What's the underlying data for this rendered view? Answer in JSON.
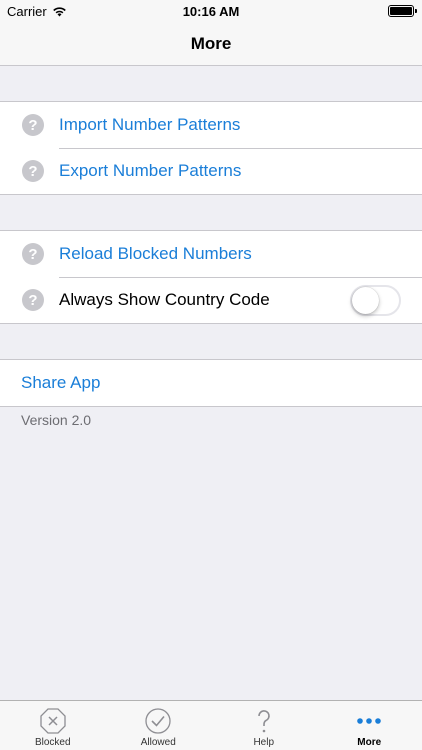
{
  "status_bar": {
    "carrier": "Carrier",
    "time": "10:16 AM"
  },
  "nav": {
    "title": "More"
  },
  "sections": {
    "patterns": [
      {
        "label": "Import Number Patterns",
        "icon": "help-icon"
      },
      {
        "label": "Export Number Patterns",
        "icon": "help-icon"
      }
    ],
    "settings": [
      {
        "label": "Reload Blocked Numbers",
        "icon": "help-icon"
      },
      {
        "label": "Always Show Country Code",
        "icon": "help-icon",
        "toggle_on": false
      }
    ],
    "share": {
      "label": "Share App"
    }
  },
  "version": "Version 2.0",
  "tabs": [
    {
      "label": "Blocked",
      "icon": "blocked-icon",
      "active": false
    },
    {
      "label": "Allowed",
      "icon": "allowed-icon",
      "active": false
    },
    {
      "label": "Help",
      "icon": "help-question-icon",
      "active": false
    },
    {
      "label": "More",
      "icon": "more-icon",
      "active": true
    }
  ],
  "colors": {
    "accent": "#1a7ed8",
    "background": "#efeff4",
    "icon_gray": "#c7c7cc"
  }
}
